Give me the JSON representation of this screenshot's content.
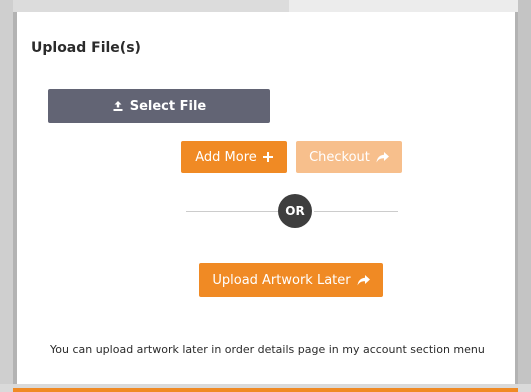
{
  "upload": {
    "heading": "Upload File(s)",
    "select_label": "Select File",
    "add_more_label": "Add More",
    "checkout_label": "Checkout",
    "or_label": "OR",
    "upload_later_label": "Upload Artwork Later",
    "note": "You can upload artwork later in order details page in my account section menu"
  },
  "icons": {
    "select": "upload-icon",
    "add_more": "plus-icon",
    "checkout": "share-arrow-icon",
    "upload_later": "share-arrow-icon"
  },
  "colors": {
    "primary_orange": "#f08a24",
    "disabled_orange": "#f7bf8c",
    "select_button": "#626474",
    "or_badge": "#3e3e3e"
  }
}
